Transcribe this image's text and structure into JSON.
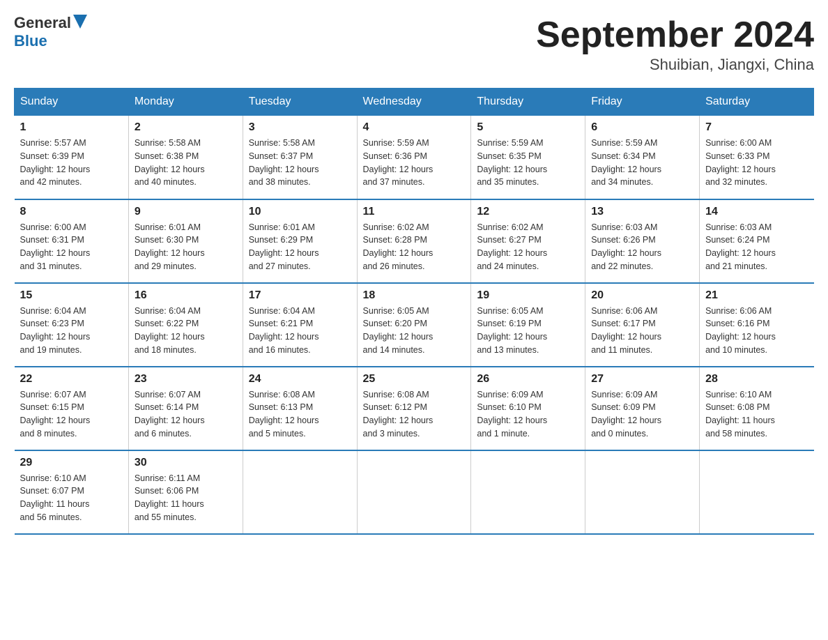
{
  "logo": {
    "text_general": "General",
    "text_blue": "Blue"
  },
  "title": "September 2024",
  "location": "Shuibian, Jiangxi, China",
  "days_of_week": [
    "Sunday",
    "Monday",
    "Tuesday",
    "Wednesday",
    "Thursday",
    "Friday",
    "Saturday"
  ],
  "weeks": [
    [
      {
        "day": "1",
        "sunrise": "5:57 AM",
        "sunset": "6:39 PM",
        "daylight": "12 hours and 42 minutes."
      },
      {
        "day": "2",
        "sunrise": "5:58 AM",
        "sunset": "6:38 PM",
        "daylight": "12 hours and 40 minutes."
      },
      {
        "day": "3",
        "sunrise": "5:58 AM",
        "sunset": "6:37 PM",
        "daylight": "12 hours and 38 minutes."
      },
      {
        "day": "4",
        "sunrise": "5:59 AM",
        "sunset": "6:36 PM",
        "daylight": "12 hours and 37 minutes."
      },
      {
        "day": "5",
        "sunrise": "5:59 AM",
        "sunset": "6:35 PM",
        "daylight": "12 hours and 35 minutes."
      },
      {
        "day": "6",
        "sunrise": "5:59 AM",
        "sunset": "6:34 PM",
        "daylight": "12 hours and 34 minutes."
      },
      {
        "day": "7",
        "sunrise": "6:00 AM",
        "sunset": "6:33 PM",
        "daylight": "12 hours and 32 minutes."
      }
    ],
    [
      {
        "day": "8",
        "sunrise": "6:00 AM",
        "sunset": "6:31 PM",
        "daylight": "12 hours and 31 minutes."
      },
      {
        "day": "9",
        "sunrise": "6:01 AM",
        "sunset": "6:30 PM",
        "daylight": "12 hours and 29 minutes."
      },
      {
        "day": "10",
        "sunrise": "6:01 AM",
        "sunset": "6:29 PM",
        "daylight": "12 hours and 27 minutes."
      },
      {
        "day": "11",
        "sunrise": "6:02 AM",
        "sunset": "6:28 PM",
        "daylight": "12 hours and 26 minutes."
      },
      {
        "day": "12",
        "sunrise": "6:02 AM",
        "sunset": "6:27 PM",
        "daylight": "12 hours and 24 minutes."
      },
      {
        "day": "13",
        "sunrise": "6:03 AM",
        "sunset": "6:26 PM",
        "daylight": "12 hours and 22 minutes."
      },
      {
        "day": "14",
        "sunrise": "6:03 AM",
        "sunset": "6:24 PM",
        "daylight": "12 hours and 21 minutes."
      }
    ],
    [
      {
        "day": "15",
        "sunrise": "6:04 AM",
        "sunset": "6:23 PM",
        "daylight": "12 hours and 19 minutes."
      },
      {
        "day": "16",
        "sunrise": "6:04 AM",
        "sunset": "6:22 PM",
        "daylight": "12 hours and 18 minutes."
      },
      {
        "day": "17",
        "sunrise": "6:04 AM",
        "sunset": "6:21 PM",
        "daylight": "12 hours and 16 minutes."
      },
      {
        "day": "18",
        "sunrise": "6:05 AM",
        "sunset": "6:20 PM",
        "daylight": "12 hours and 14 minutes."
      },
      {
        "day": "19",
        "sunrise": "6:05 AM",
        "sunset": "6:19 PM",
        "daylight": "12 hours and 13 minutes."
      },
      {
        "day": "20",
        "sunrise": "6:06 AM",
        "sunset": "6:17 PM",
        "daylight": "12 hours and 11 minutes."
      },
      {
        "day": "21",
        "sunrise": "6:06 AM",
        "sunset": "6:16 PM",
        "daylight": "12 hours and 10 minutes."
      }
    ],
    [
      {
        "day": "22",
        "sunrise": "6:07 AM",
        "sunset": "6:15 PM",
        "daylight": "12 hours and 8 minutes."
      },
      {
        "day": "23",
        "sunrise": "6:07 AM",
        "sunset": "6:14 PM",
        "daylight": "12 hours and 6 minutes."
      },
      {
        "day": "24",
        "sunrise": "6:08 AM",
        "sunset": "6:13 PM",
        "daylight": "12 hours and 5 minutes."
      },
      {
        "day": "25",
        "sunrise": "6:08 AM",
        "sunset": "6:12 PM",
        "daylight": "12 hours and 3 minutes."
      },
      {
        "day": "26",
        "sunrise": "6:09 AM",
        "sunset": "6:10 PM",
        "daylight": "12 hours and 1 minute."
      },
      {
        "day": "27",
        "sunrise": "6:09 AM",
        "sunset": "6:09 PM",
        "daylight": "12 hours and 0 minutes."
      },
      {
        "day": "28",
        "sunrise": "6:10 AM",
        "sunset": "6:08 PM",
        "daylight": "11 hours and 58 minutes."
      }
    ],
    [
      {
        "day": "29",
        "sunrise": "6:10 AM",
        "sunset": "6:07 PM",
        "daylight": "11 hours and 56 minutes."
      },
      {
        "day": "30",
        "sunrise": "6:11 AM",
        "sunset": "6:06 PM",
        "daylight": "11 hours and 55 minutes."
      },
      null,
      null,
      null,
      null,
      null
    ]
  ],
  "labels": {
    "sunrise": "Sunrise:",
    "sunset": "Sunset:",
    "daylight": "Daylight:"
  }
}
